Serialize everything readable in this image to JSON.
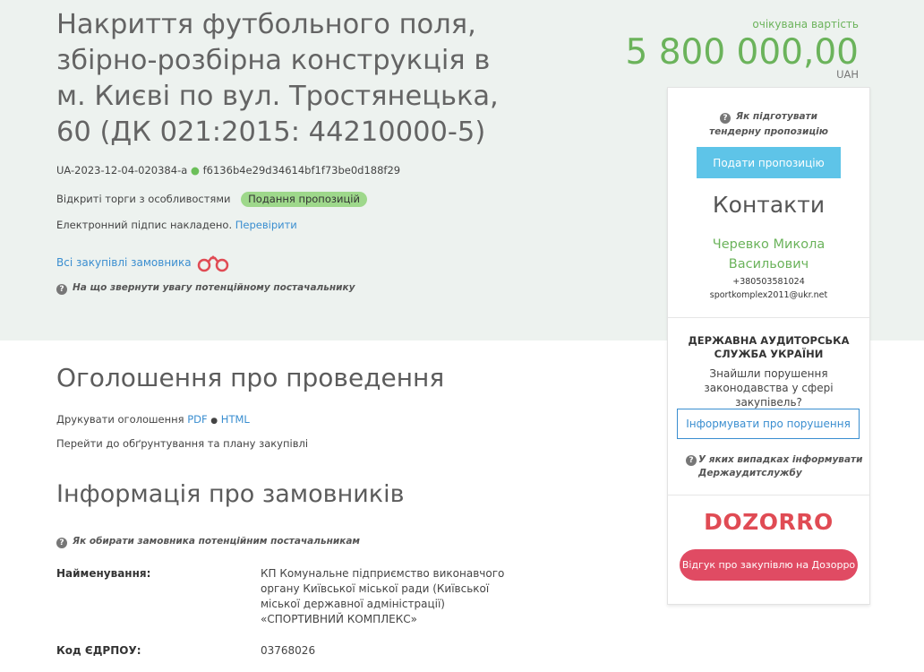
{
  "tender": {
    "title": "Накриття футбольного поля, збірно-розбірна конструкція в м. Києві по вул. Тростянецька, 60 (ДК 021:2015: 44210000-5)",
    "id": "UA-2023-12-04-020384-a",
    "hash": "f6136b4e29d34614bf1f73be0d188f29",
    "procedure": "Відкриті торги з особливостями",
    "status_badge": "Подання пропозицій",
    "signature_text": "Електронний підпис накладено.",
    "signature_link": "Перевірити",
    "all_purchases_link": "Всі закупівлі замовника",
    "attention_hint": "На що звернути увагу потенційному постачальнику"
  },
  "price": {
    "label": "очікувана вартість",
    "value": "5 800 000,00",
    "currency": "UAH"
  },
  "announcement": {
    "heading": "Оголошення про проведення",
    "print_label": "Друкувати оголошення",
    "pdf_link": "PDF",
    "separator": "●",
    "html_link": "HTML",
    "plan_link": "Перейти до обґрунтування та плану закупівлі"
  },
  "customers": {
    "heading": "Інформація про замовників",
    "hint": "Як обирати замовника потенційним постачальникам",
    "name_label": "Найменування:",
    "name_value": "КП Комунальне підприємство виконавчого органу Київської міської ради (Київської міської державної адміністрації) «СПОРТИВНИЙ КОМПЛЕКС»",
    "edrpou_label": "Код ЄДРПОУ:",
    "edrpou_value": "03768026"
  },
  "sidebar": {
    "prep_hint": "Як підготувати тендерну пропозицію",
    "submit_button": "Подати пропозицію",
    "contacts_title": "Контакти",
    "contact_name": "Черевко Микола Васильович",
    "contact_phone": "+380503581024",
    "contact_email": "sportkomplex2011@ukr.net",
    "audit_title": "ДЕРЖАВНА АУДИТОРСЬКА СЛУЖБА УКРАЇНИ",
    "audit_text": "Знайшли порушення законодавства у сфері закупівель?",
    "report_button": "Інформувати про порушення",
    "audit_hint": "У яких випадках інформувати Держаудитслужбу",
    "dozorro_logo": "DOZORRO",
    "dozorro_button": "Відгук про закупівлю на Дозорро"
  },
  "colors": {
    "accent_green": "#6bb35b",
    "link_blue": "#3a8ed0",
    "submit_blue": "#5ec4e8",
    "dozorro_red": "#e04b54",
    "hero_bg": "#edf2ef",
    "badge_green": "#9ed88b"
  },
  "icons": {
    "question": "question-circle-icon",
    "binoculars": "binoculars-icon"
  }
}
